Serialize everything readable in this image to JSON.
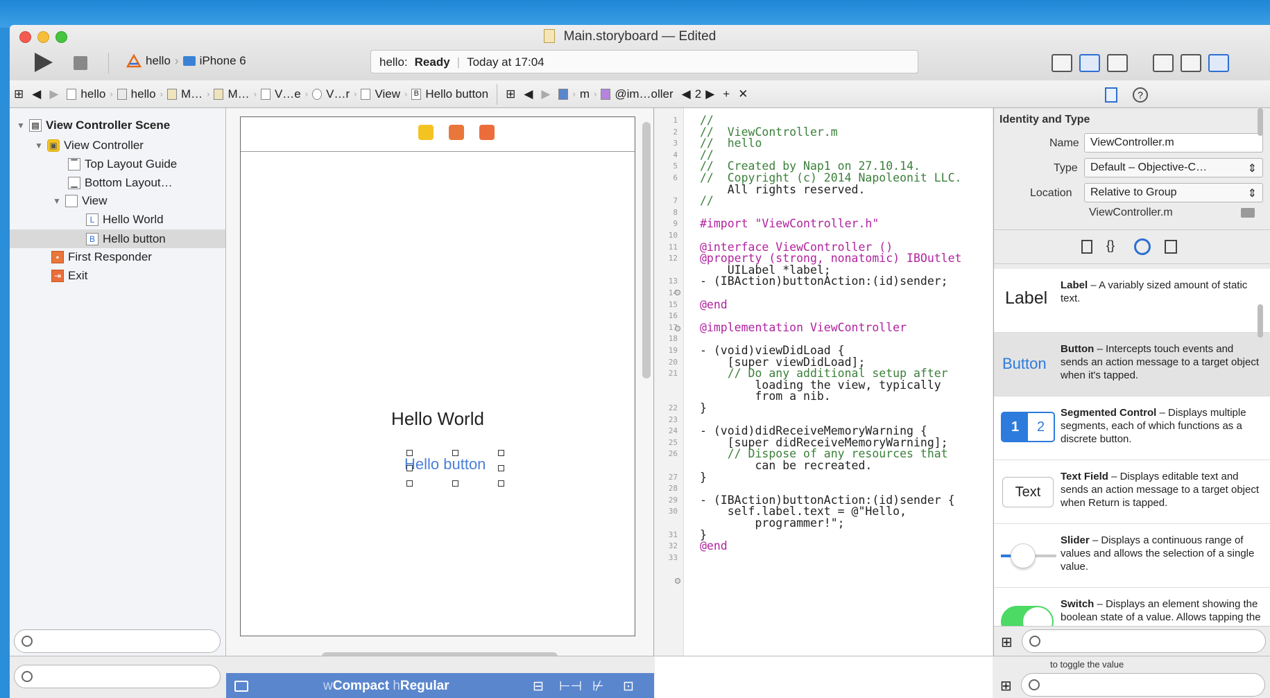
{
  "window": {
    "title": "Main.storyboard — Edited",
    "scheme_project": "hello",
    "scheme_device": "iPhone 6",
    "status_project": "hello:",
    "status_state": "Ready",
    "status_time": "Today at 17:04"
  },
  "jumpbar": {
    "crumbs": [
      "hello",
      "hello",
      "M…",
      "M…",
      "V…e",
      "V…r",
      "View",
      "Hello button"
    ],
    "right_crumbs": [
      "m",
      "@im…oller",
      "2"
    ]
  },
  "outline": {
    "items": [
      {
        "label": "View Controller Scene"
      },
      {
        "label": "View Controller"
      },
      {
        "label": "Top Layout Guide"
      },
      {
        "label": "Bottom Layout…"
      },
      {
        "label": "View"
      },
      {
        "label": "Hello World",
        "badge": "L"
      },
      {
        "label": "Hello button",
        "badge": "B"
      },
      {
        "label": "First Responder"
      },
      {
        "label": "Exit"
      }
    ]
  },
  "canvas": {
    "label_text": "Hello World",
    "button_text": "Hello button",
    "size_w": "w",
    "size_w_value": "Compact",
    "size_h": "h",
    "size_h_value": "Regular"
  },
  "code": {
    "lines": [
      {
        "n": "1",
        "t": "//"
      },
      {
        "n": "2",
        "t": "//  ViewController.m"
      },
      {
        "n": "3",
        "t": "//  hello"
      },
      {
        "n": "4",
        "t": "//"
      },
      {
        "n": "5",
        "t": "//  Created by Nap1 on 27.10.14."
      },
      {
        "n": "6",
        "t": "//  Copyright (c) 2014 Napoleonit LLC."
      },
      {
        "n": "",
        "t": "    All rights reserved."
      },
      {
        "n": "7",
        "t": "//"
      },
      {
        "n": "8",
        "t": ""
      },
      {
        "n": "9",
        "t": "#import \"ViewController.h\""
      },
      {
        "n": "10",
        "t": ""
      },
      {
        "n": "11",
        "t": "@interface ViewController ()"
      },
      {
        "n": "12",
        "t": "@property (strong, nonatomic) IBOutlet"
      },
      {
        "n": "",
        "t": "    UILabel *label;"
      },
      {
        "n": "13",
        "t": "- (IBAction)buttonAction:(id)sender;"
      },
      {
        "n": "14",
        "t": ""
      },
      {
        "n": "15",
        "t": "@end"
      },
      {
        "n": "16",
        "t": ""
      },
      {
        "n": "17",
        "t": "@implementation ViewController"
      },
      {
        "n": "18",
        "t": ""
      },
      {
        "n": "19",
        "t": "- (void)viewDidLoad {"
      },
      {
        "n": "20",
        "t": "    [super viewDidLoad];"
      },
      {
        "n": "21",
        "t": "    // Do any additional setup after"
      },
      {
        "n": "",
        "t": "        loading the view, typically"
      },
      {
        "n": "",
        "t": "        from a nib."
      },
      {
        "n": "22",
        "t": "}"
      },
      {
        "n": "23",
        "t": ""
      },
      {
        "n": "24",
        "t": "- (void)didReceiveMemoryWarning {"
      },
      {
        "n": "25",
        "t": "    [super didReceiveMemoryWarning];"
      },
      {
        "n": "26",
        "t": "    // Dispose of any resources that"
      },
      {
        "n": "",
        "t": "        can be recreated."
      },
      {
        "n": "27",
        "t": "}"
      },
      {
        "n": "28",
        "t": ""
      },
      {
        "n": "29",
        "t": "- (IBAction)buttonAction:(id)sender {"
      },
      {
        "n": "30",
        "t": "    self.label.text = @\"Hello,"
      },
      {
        "n": "",
        "t": "        programmer!\";"
      },
      {
        "n": "31",
        "t": "}"
      },
      {
        "n": "32",
        "t": "@end"
      },
      {
        "n": "33",
        "t": ""
      }
    ]
  },
  "inspector": {
    "section_title": "Identity and Type",
    "name_label": "Name",
    "name_value": "ViewController.m",
    "type_label": "Type",
    "type_value": "Default – Objective-C…",
    "location_label": "Location",
    "location_value": "Relative to Group",
    "full_path": "ViewController.m",
    "help_glyph": "?"
  },
  "library": {
    "items": [
      {
        "preview": "Label",
        "title": "Label",
        "desc": " – A variably sized amount of static text."
      },
      {
        "preview": "Button",
        "title": "Button",
        "desc": " – Intercepts touch events and sends an action message to a target object when it's tapped."
      },
      {
        "preview_1": "1",
        "preview_2": "2",
        "title": "Segmented Control",
        "desc": " – Displays multiple segments, each of which functions as a discrete button."
      },
      {
        "preview": "Text",
        "title": "Text Field",
        "desc": " – Displays editable text and sends an action message to a target object when Return is tapped."
      },
      {
        "title": "Slider",
        "desc": " – Displays a continuous range of values and allows the selection of a single value."
      },
      {
        "title": "Switch",
        "desc": " – Displays an element showing the boolean state of a value. Allows tapping the control to toggle the value."
      }
    ],
    "ghost_text": "to toggle the value"
  },
  "colors": {
    "selection_blue": "#5a86ce",
    "code_comment": "#3a7f3a",
    "code_keyword": "#b0239e",
    "code_string": "#c41a16",
    "switch_green": "#4cd964",
    "button_blue": "#4a7fd8"
  }
}
